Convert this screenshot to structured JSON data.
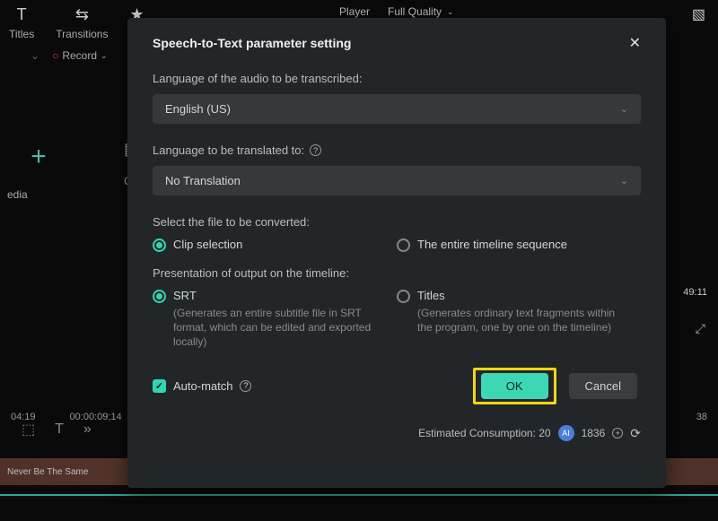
{
  "bg": {
    "topItems": [
      "Titles",
      "Transitions",
      "Ef"
    ],
    "player": "Player",
    "quality": "Full Quality",
    "record": "Record",
    "media": "edia",
    "ch": "Ch",
    "tc1": "04:19",
    "tc2": "00:00:09;14",
    "tc3": "38",
    "rightTime": "49:11",
    "thumb": "Never Be The Same"
  },
  "modal": {
    "title": "Speech-to-Text parameter setting",
    "lang_label": "Language of the audio to be transcribed:",
    "lang_value": "English (US)",
    "translate_label": "Language to be translated to:",
    "translate_value": "No Translation",
    "select_label": "Select the file to be converted:",
    "radio_clip": "Clip selection",
    "radio_timeline": "The entire timeline sequence",
    "present_label": "Presentation of output on the timeline:",
    "radio_srt": "SRT",
    "srt_desc": "(Generates an entire subtitle file in SRT format, which can be edited and exported locally)",
    "radio_titles": "Titles",
    "titles_desc": "(Generates ordinary text fragments within the program, one by one on the timeline)",
    "estimated": "Estimated Consumption: 20",
    "credits": "1836",
    "auto_match": "Auto-match",
    "ok": "OK",
    "cancel": "Cancel"
  }
}
